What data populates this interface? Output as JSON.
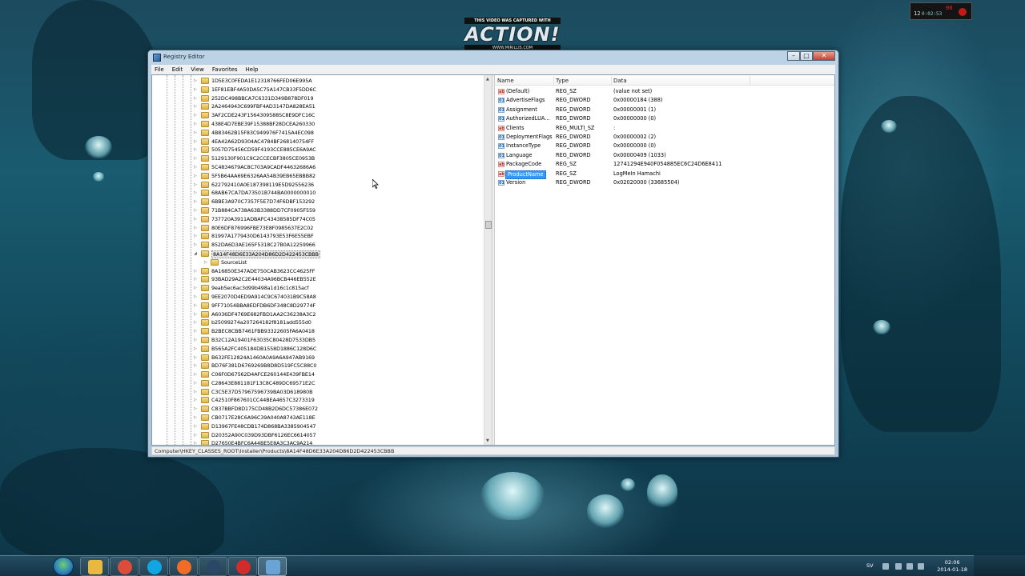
{
  "capture_banner": {
    "top": "THIS VIDEO WAS CAPTURED WITH",
    "logo": "ACTION!",
    "url": "WWW.MIRILLIS.COM"
  },
  "recorder": {
    "count": "12",
    "time": "0:02:53",
    "red": "00"
  },
  "window": {
    "title": "Registry Editor",
    "menu": [
      "File",
      "Edit",
      "View",
      "Favorites",
      "Help"
    ],
    "statusbar": "Computer\\HKEY_CLASSES_ROOT\\Installer\\Products\\8A14F48D6E33A204D86D2D422453CBBB"
  },
  "tree": {
    "rows": [
      {
        "label": "1D5E3C0FEDA1E12318766FED06E995A",
        "type": "key"
      },
      {
        "label": "1EF81EBF4A50DA5C75A147CB33F5DD6C",
        "type": "key"
      },
      {
        "label": "252DC498BBCA7C6331D349B878DF019",
        "type": "key"
      },
      {
        "label": "2A2464943C699FBF4AD3147DA828EA51",
        "type": "key"
      },
      {
        "label": "3AF2CDE243F1564309588SC8E9DFC16C",
        "type": "key"
      },
      {
        "label": "438E4D7EBE39F15388BF28DCEA260330",
        "type": "key"
      },
      {
        "label": "4B83462B15F83C949976F7415A4EC098",
        "type": "key"
      },
      {
        "label": "4EA42A62D9304AC4784BF268140754FF",
        "type": "key"
      },
      {
        "label": "5057D75456CD59F4193CCE885CE6A9AC",
        "type": "key"
      },
      {
        "label": "5129130F901C9C2CCECBF3805CE0953B",
        "type": "key"
      },
      {
        "label": "5C4834679AC8C703A9CADF44632686A6",
        "type": "key"
      },
      {
        "label": "5F5B64AA69E6326AA54B39EB65EBBB82",
        "type": "key"
      },
      {
        "label": "622792410A0E187398119E5D92556236",
        "type": "key"
      },
      {
        "label": "68AB67CA7DA73501B744BA0000000010",
        "type": "key"
      },
      {
        "label": "6BBE3A970C7357F5E7D74F6DBF153292",
        "type": "key"
      },
      {
        "label": "71B884CA738A63B3388DD7CF0905F559",
        "type": "key"
      },
      {
        "label": "737720A3911ADBAFC43438585DF74C05",
        "type": "key"
      },
      {
        "label": "80E6DF876996FBE73E8F0985637E2C02",
        "type": "key"
      },
      {
        "label": "81997A1779430D6143793E53F6E55EBF",
        "type": "key"
      },
      {
        "label": "852DA6D3AE165F5318C27B0A12259966",
        "type": "key"
      },
      {
        "label": "8A14F48D6E33A204D86D2D422453CBBB",
        "type": "expanded-selected"
      },
      {
        "label": "SourceList",
        "type": "child"
      },
      {
        "label": "8A16850E347ADE750CAB3623CC4625FF",
        "type": "key"
      },
      {
        "label": "93BAD29A2C2E44034A96BCB446EB552E",
        "type": "key"
      },
      {
        "label": "9eab5ec6ac3d99b498a1d16c1c815acf",
        "type": "key"
      },
      {
        "label": "9EE2070D4ED9A914C9C674031B9C58A8",
        "type": "key"
      },
      {
        "label": "9FF71054BBA8EDFDB6DF348C8D29774F",
        "type": "key"
      },
      {
        "label": "A6036DF4769E682FBD1AA2C36238A3C2",
        "type": "key"
      },
      {
        "label": "b25099274a207264182f8181add555d0",
        "type": "key"
      },
      {
        "label": "B2BEC8CBB7461FBB93322605FA6A0418",
        "type": "key"
      },
      {
        "label": "B32C12A19401F63035C80428D7533DB5",
        "type": "key"
      },
      {
        "label": "B565A2FC405184DB1558D1886C128D6C",
        "type": "key"
      },
      {
        "label": "B632FE12824A1460A0A9A6A947AB9169",
        "type": "key"
      },
      {
        "label": "BD76F381D6769269B8D8D519FC5C88C0",
        "type": "key"
      },
      {
        "label": "C06F0D67562D4AFCE260144E439FBE14",
        "type": "key"
      },
      {
        "label": "C28643E881181F13C8C489DC69571E2C",
        "type": "key"
      },
      {
        "label": "C3C5E37D57967596739BA03D618980B",
        "type": "key"
      },
      {
        "label": "C42510F867601CC44BEA4657C3273319",
        "type": "key"
      },
      {
        "label": "C837BBFD8D175CD48B2D6DC57386E072",
        "type": "key"
      },
      {
        "label": "CB0717E28C6A96C39A040A8743AE118E",
        "type": "key"
      },
      {
        "label": "D13967FE48CDB174D868BA3385904547",
        "type": "key"
      },
      {
        "label": "D20352A90C039D93DBF6126EC6614057",
        "type": "key"
      },
      {
        "label": "D27650E4BFC6A44BE5E8A3C3AC9A214",
        "type": "key"
      }
    ]
  },
  "values": {
    "columns": [
      "Name",
      "Type",
      "Data"
    ],
    "rows": [
      {
        "name": "(Default)",
        "type": "REG_SZ",
        "data": "(value not set)",
        "icon": "sz"
      },
      {
        "name": "AdvertiseFlags",
        "type": "REG_DWORD",
        "data": "0x00000184 (388)",
        "icon": "bin"
      },
      {
        "name": "Assignment",
        "type": "REG_DWORD",
        "data": "0x00000001 (1)",
        "icon": "bin"
      },
      {
        "name": "AuthorizedLUA...",
        "type": "REG_DWORD",
        "data": "0x00000000 (0)",
        "icon": "bin"
      },
      {
        "name": "Clients",
        "type": "REG_MULTI_SZ",
        "data": ":",
        "icon": "sz"
      },
      {
        "name": "DeploymentFlags",
        "type": "REG_DWORD",
        "data": "0x00000002 (2)",
        "icon": "bin"
      },
      {
        "name": "InstanceType",
        "type": "REG_DWORD",
        "data": "0x00000000 (0)",
        "icon": "bin"
      },
      {
        "name": "Language",
        "type": "REG_DWORD",
        "data": "0x00000409 (1033)",
        "icon": "bin"
      },
      {
        "name": "PackageCode",
        "type": "REG_SZ",
        "data": "12741294E940F054885EC6C24D6E8411",
        "icon": "sz"
      },
      {
        "name": "ProductName",
        "type": "REG_SZ",
        "data": "LogMeIn Hamachi",
        "icon": "sz",
        "selected": true
      },
      {
        "name": "Version",
        "type": "REG_DWORD",
        "data": "0x02020000 (33685504)",
        "icon": "bin"
      }
    ]
  },
  "taskbar": {
    "apps": [
      {
        "name": "explorer",
        "color": "#e8b840"
      },
      {
        "name": "chrome",
        "color": "#dd4b39"
      },
      {
        "name": "skype",
        "color": "#12a5e4"
      },
      {
        "name": "origin",
        "color": "#f26c26"
      },
      {
        "name": "unreal",
        "color": "#2b4766"
      },
      {
        "name": "action-recorder",
        "color": "#d12b2b"
      },
      {
        "name": "registry-editor",
        "color": "#6aa3d6"
      }
    ],
    "lang": "SV",
    "time": "02:06",
    "date": "2014-01-18"
  }
}
